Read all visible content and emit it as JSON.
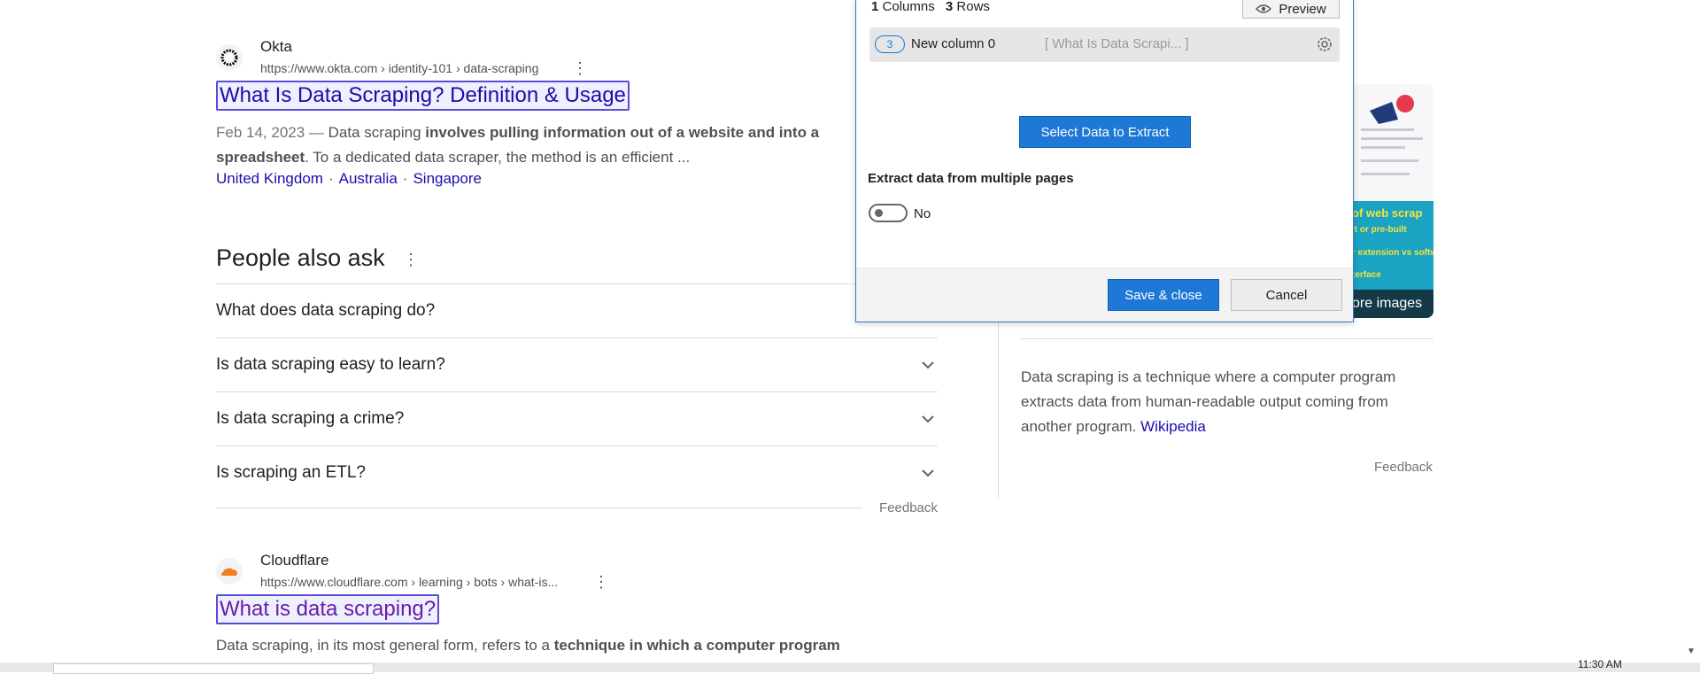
{
  "results": [
    {
      "site": "Okta",
      "url": "https://www.okta.com › identity-101 › data-scraping",
      "title": "What Is Data Scraping? Definition & Usage",
      "date": "Feb 14, 2023 —",
      "snippet_1": "Data scraping",
      "snippet_2": "involves pulling information out of a website and into a",
      "snippet_3": "spreadsheet",
      "snippet_4": ". To a dedicated data scraper, the method is an efficient ...",
      "sitelinks": [
        "United Kingdom",
        "Australia",
        "Singapore"
      ]
    },
    {
      "site": "Cloudflare",
      "url": "https://www.cloudflare.com › learning › bots › what-is...",
      "title": "What is data scraping?",
      "snippet_1": "Data scraping, in its most general form, refers to a",
      "snippet_2": "technique in which a computer program"
    }
  ],
  "paa": {
    "title": "People also ask",
    "items": [
      "What does data scraping do?",
      "Is data scraping easy to learn?",
      "Is data scraping a crime?",
      "Is scraping an ETL?"
    ],
    "feedback": "Feedback"
  },
  "knowledge_panel": {
    "text": "Data scraping is a technique where a computer program extracts data from human-readable output coming from another program.",
    "link": "Wikipedia",
    "more_images": "ore images",
    "feedback": "Feedback",
    "image_lines": [
      "of web scrap",
      "lt or pre-built",
      "r extension vs softw",
      "terface"
    ]
  },
  "dialog": {
    "columns_count": "1",
    "columns_label": "Columns",
    "rows_count": "3",
    "rows_label": "Rows",
    "preview": "Preview",
    "column_badge": "3",
    "column_name": "New column 0",
    "column_preview": "[ What Is Data Scrapi... ]",
    "select_button": "Select Data to Extract",
    "multi_page_label": "Extract data from multiple pages",
    "toggle_value": "No",
    "save_button": "Save & close",
    "cancel_button": "Cancel"
  },
  "taskbar": {
    "clock": "11:30 AM"
  }
}
